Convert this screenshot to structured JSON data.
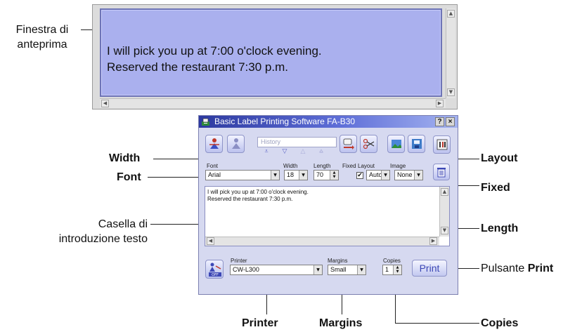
{
  "callouts": {
    "preview_label": "Finestra di\nanteprima",
    "width": "Width",
    "font": "Font",
    "text_box": "Casella di\nintroduzione testo",
    "layout": "Layout",
    "fixed": "Fixed",
    "length": "Length",
    "print_prefix": "Pulsante ",
    "print_bold": "Print",
    "printer": "Printer",
    "margins": "Margins",
    "copies": "Copies"
  },
  "preview": {
    "line1": "I will pick you up at 7:00 o'clock evening.",
    "line2": "Reserved the restaurant 7:30 p.m."
  },
  "app": {
    "title": "Basic Label Printing Software FA-B30",
    "help_label": "?",
    "close_label": "×",
    "history_placeholder": "History",
    "labels": {
      "font": "Font",
      "width": "Width",
      "length": "Length",
      "fixed": "Fixed",
      "layout": "Layout",
      "image": "Image",
      "printer": "Printer",
      "margins": "Margins",
      "copies": "Copies"
    },
    "values": {
      "font": "Arial",
      "width": "18",
      "length": "70",
      "fixed_checked": true,
      "layout": "Auto",
      "image": "None",
      "printer": "CW-L300",
      "margins": "Small",
      "copies": "1"
    },
    "text_lines": [
      "I will pick you up at 7:00 o'clock evening.",
      "Reserved the restaurant 7:30 p.m."
    ],
    "print_button": "Print",
    "off_label": "OFF"
  },
  "colors": {
    "preview_bg": "#aab0ee",
    "window_bg": "#d6d9f0",
    "accent": "#3c47b5",
    "titlebar": "#2d3aa0"
  }
}
